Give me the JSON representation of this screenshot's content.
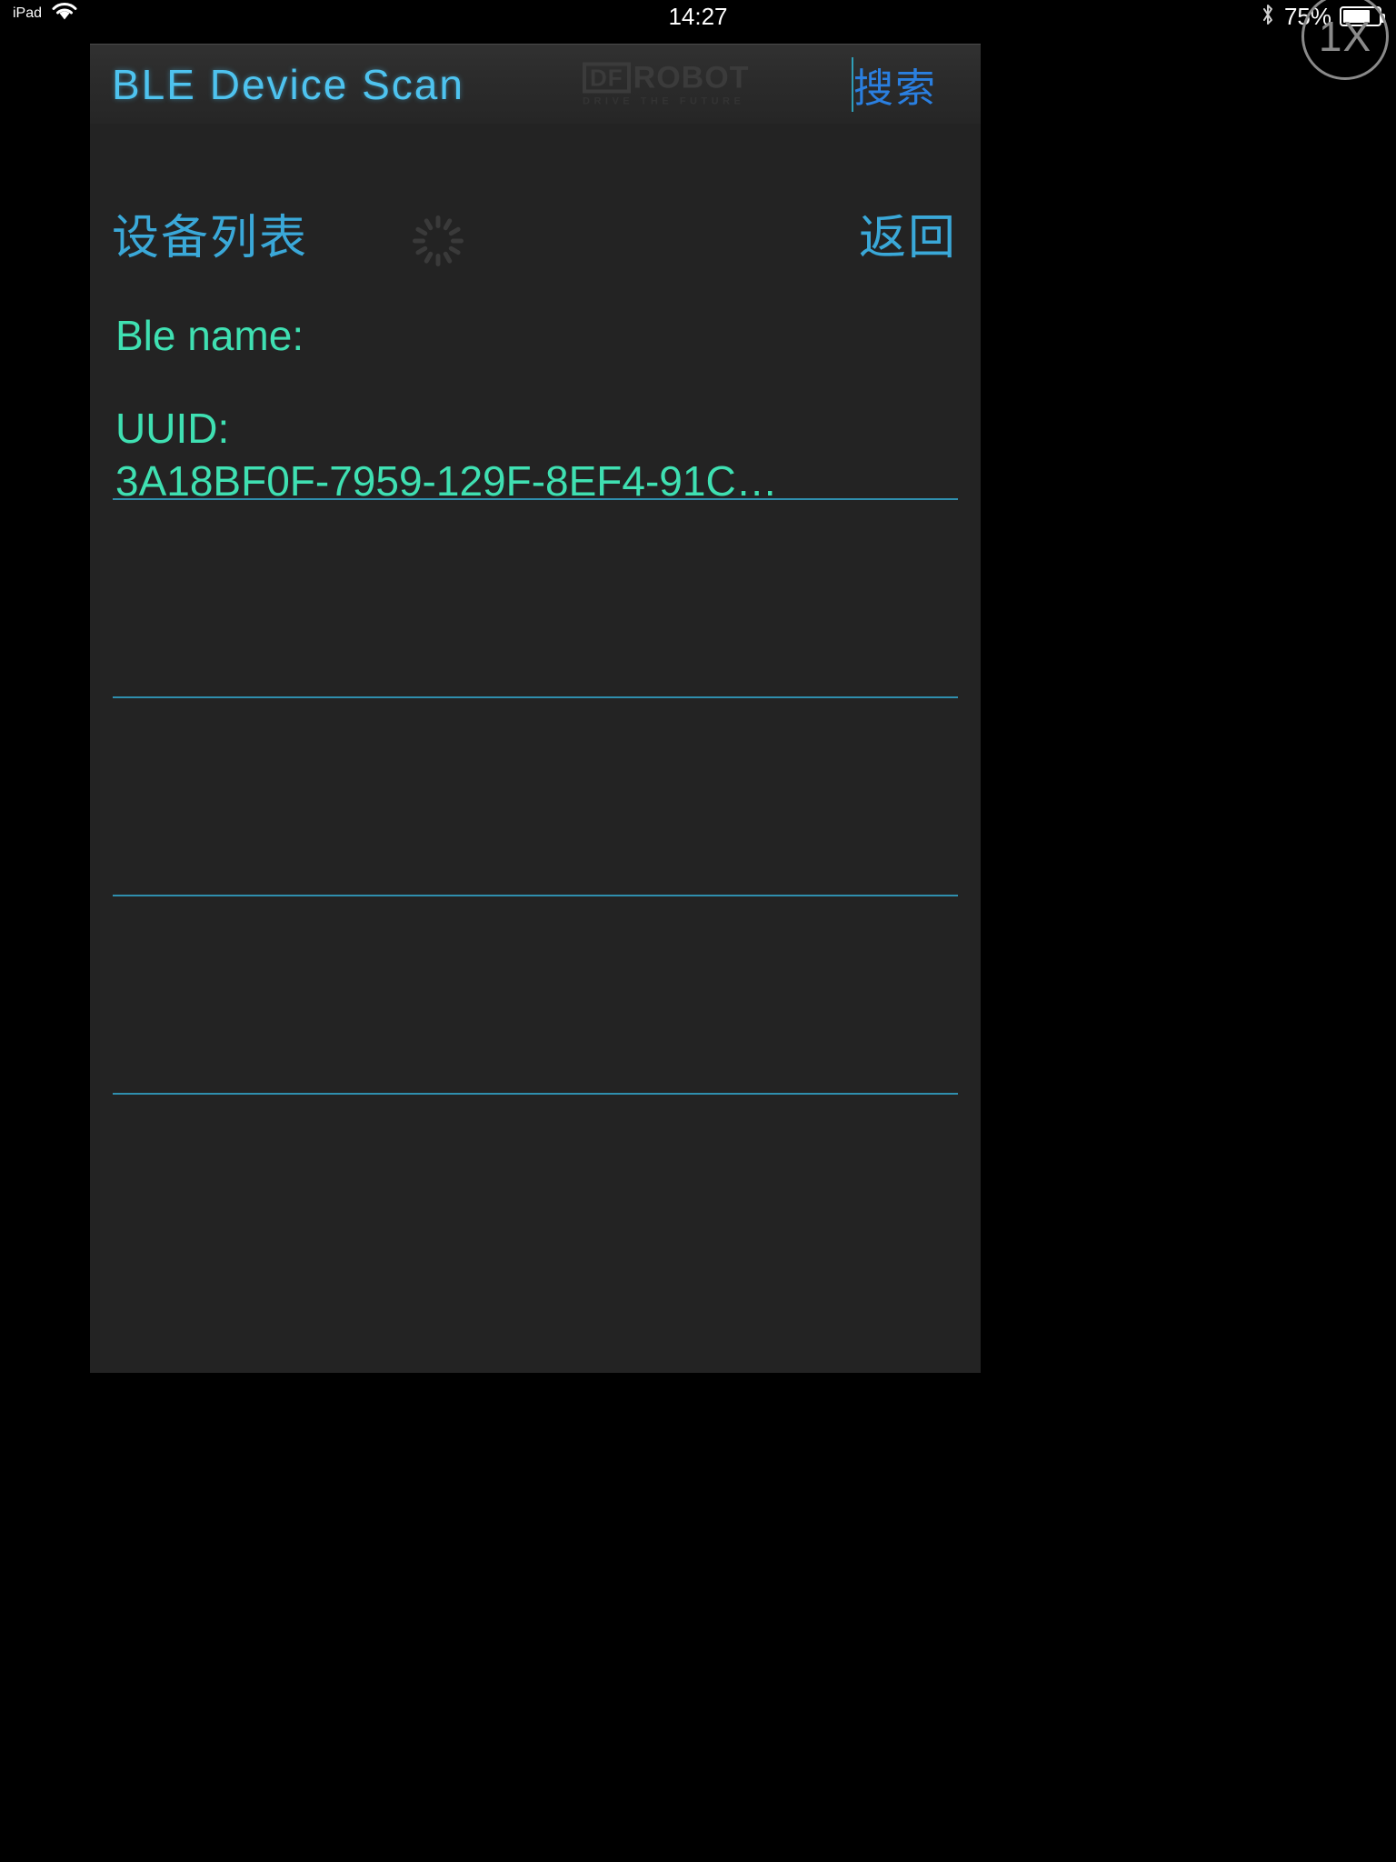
{
  "status_bar": {
    "carrier": "iPad",
    "wifi_icon": "wifi-icon",
    "time": "14:27",
    "bluetooth_icon": "bluetooth-icon",
    "battery_percent": "75%",
    "battery_level": 75
  },
  "zoom_badge": {
    "label": "1X"
  },
  "app_bar": {
    "title": "BLE Device Scan",
    "brand_df": "DF",
    "brand_robot": "ROBOT",
    "brand_tagline": "DRIVE THE FUTURE",
    "search_label": "搜索"
  },
  "list_bar": {
    "title": "设备列表",
    "spinner_icon": "loading-spinner-icon",
    "back_label": "返回"
  },
  "devices": [
    {
      "ble_name": "Ble name:",
      "uuid_label": "UUID:",
      "uuid_value": "3A18BF0F-7959-129F-8EF4-91C…"
    },
    {
      "ble_name": "",
      "uuid_label": "",
      "uuid_value": ""
    },
    {
      "ble_name": "",
      "uuid_label": "",
      "uuid_value": ""
    },
    {
      "ble_name": "",
      "uuid_label": "",
      "uuid_value": ""
    }
  ],
  "colors": {
    "accent_blue": "#3aa8d8",
    "title_blue": "#4ec3ef",
    "search_blue": "#2a7fe0",
    "device_green": "#3fe0b2",
    "divider_teal": "#2f8fae",
    "app_bg": "#232323"
  }
}
